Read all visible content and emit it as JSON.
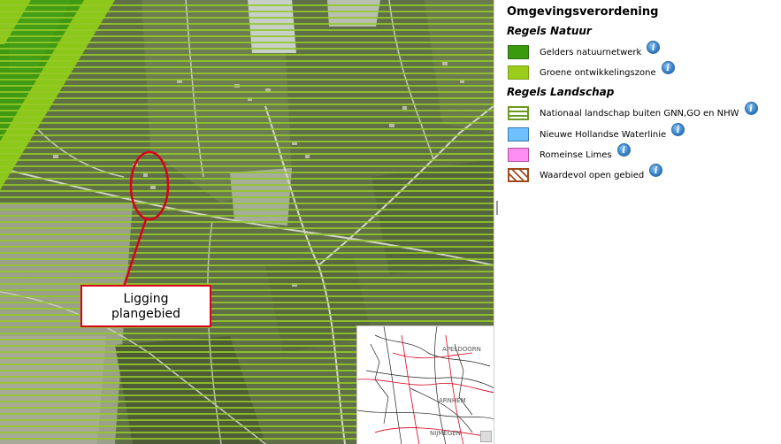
{
  "map": {
    "callout_line1": "Ligging",
    "callout_line2": "plangebied",
    "overview_labels": [
      "APELDOORN",
      "ARNHEM",
      "NIJMEGEN"
    ]
  },
  "legend": {
    "title": "Omgevingsverordening",
    "sections": [
      {
        "heading": "Regels Natuur",
        "items": [
          {
            "label": "Gelders natuurnetwerk",
            "color": "#3a9a0e",
            "style": "solid"
          },
          {
            "label": "Groene ontwikkelingszone",
            "color": "#9ccc1c",
            "style": "solid"
          }
        ]
      },
      {
        "heading": "Regels Landschap",
        "items": [
          {
            "label": "Nationaal landschap buiten GNN,GO en NHW",
            "color": "#6a9a20",
            "style": "stripes-horizontal"
          },
          {
            "label": "Nieuwe Hollandse Waterlinie",
            "color": "#6ec0ff",
            "style": "solid"
          },
          {
            "label": "Romeinse Limes",
            "color": "#ff8cf0",
            "style": "solid"
          },
          {
            "label": "Waardevol open gebied",
            "color": "#a04a1a",
            "style": "hatch-diagonal"
          }
        ]
      }
    ],
    "info_icon_glyph": "i"
  }
}
